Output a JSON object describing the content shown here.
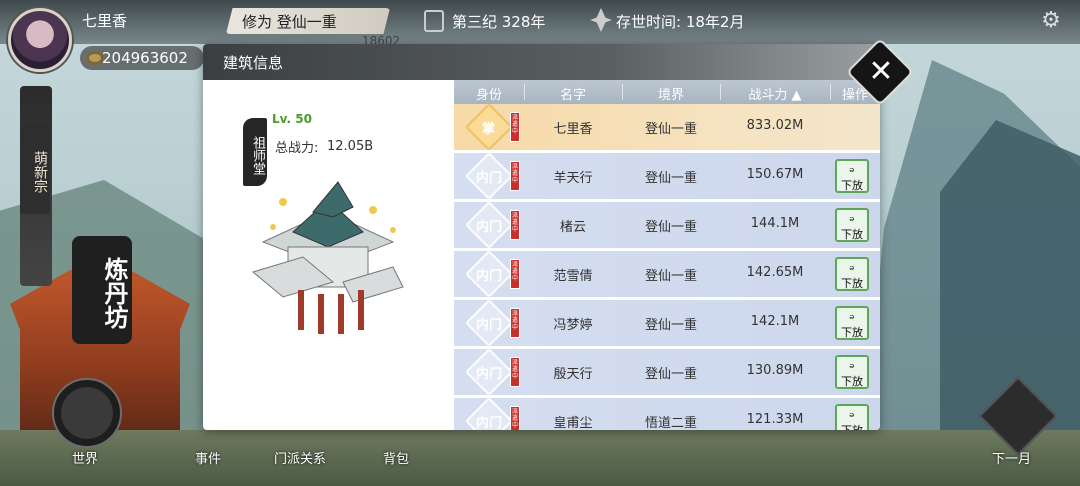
{
  "player": {
    "name": "七里香",
    "currency": "204963602",
    "realm": "修为  登仙一重",
    "realm_sub": "18602",
    "era": "第三纪 328年",
    "survival": "存世时间: 18年2月"
  },
  "side": {
    "sect_label": "萌新宗",
    "alchemy_label": "炼丹坊"
  },
  "nav": {
    "world": "世界",
    "events": "事件",
    "relations": "门派关系",
    "bag": "背包",
    "next_month": "下一月"
  },
  "modal": {
    "title": "建筑信息",
    "building": {
      "name": "祖师堂",
      "level": "Lv. 50",
      "power_label": "总战力:",
      "power_value": "12.05B"
    },
    "table": {
      "headers": [
        "身份",
        "名字",
        "境界",
        "战斗力 ▲",
        "操作"
      ],
      "rows": [
        {
          "identity": "掌",
          "badge": "派遣中",
          "name": "七里香",
          "realm": "登仙一重",
          "power": "833.02M",
          "self": true,
          "action": ""
        },
        {
          "identity": "内门",
          "badge": "派遣中",
          "name": "羊天行",
          "realm": "登仙一重",
          "power": "150.67M",
          "self": false,
          "action": "下放"
        },
        {
          "identity": "内门",
          "badge": "派遣中",
          "name": "楮云",
          "realm": "登仙一重",
          "power": "144.1M",
          "self": false,
          "action": "下放"
        },
        {
          "identity": "内门",
          "badge": "派遣中",
          "name": "范雪倩",
          "realm": "登仙一重",
          "power": "142.65M",
          "self": false,
          "action": "下放"
        },
        {
          "identity": "内门",
          "badge": "派遣中",
          "name": "冯梦婷",
          "realm": "登仙一重",
          "power": "142.1M",
          "self": false,
          "action": "下放"
        },
        {
          "identity": "内门",
          "badge": "派遣中",
          "name": "殷天行",
          "realm": "登仙一重",
          "power": "130.89M",
          "self": false,
          "action": "下放"
        },
        {
          "identity": "内门",
          "badge": "派遣中",
          "name": "皇甫尘",
          "realm": "悟道二重",
          "power": "121.33M",
          "self": false,
          "action": "下放"
        }
      ]
    }
  },
  "colors": {
    "self_row": "#f7d9a7",
    "row": "#d5def0",
    "release_border": "#5fa55a",
    "badge": "#c9302c",
    "level_green": "#4a9c2b"
  },
  "icons": {
    "gear": "gear-icon",
    "close": "close-icon",
    "coin": "coin-icon"
  }
}
